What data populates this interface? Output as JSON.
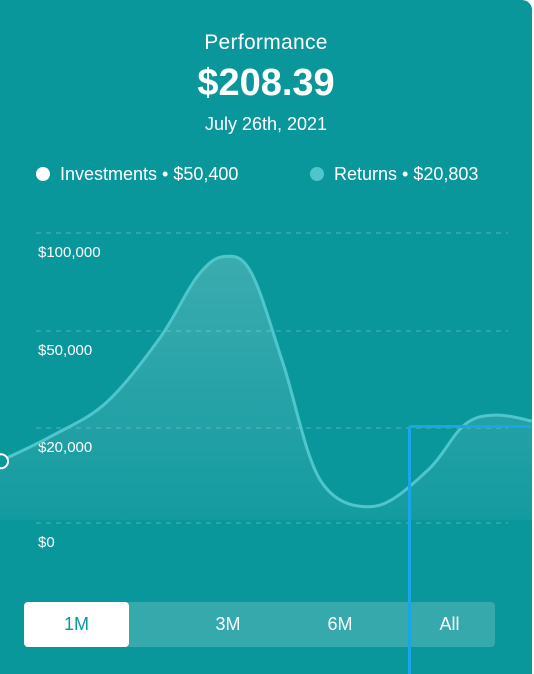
{
  "header": {
    "title": "Performance",
    "amount": "$208.39",
    "date": "July 26th, 2021"
  },
  "legend": [
    {
      "label": "Investments",
      "value": "$50,400",
      "color": "#ffffff"
    },
    {
      "label": "Returns",
      "value": "$20,803",
      "color": "#4fc6cb"
    }
  ],
  "legend_separator": "•",
  "colors": {
    "card_background": "#0a979c",
    "curve_line": "#4fc6cb",
    "selection_outline": "#1aa6e6"
  },
  "chart_data": {
    "type": "area",
    "y_tick_labels": [
      "$100,000",
      "$50,000",
      "$20,000",
      "$0"
    ],
    "grid": true,
    "series": [
      {
        "color": "#4fc6cb",
        "points": [
          {
            "x": 0,
            "y": 13000
          },
          {
            "x": 0.1,
            "y": 18500
          },
          {
            "x": 0.2,
            "y": 28000
          },
          {
            "x": 0.3,
            "y": 48000
          },
          {
            "x": 0.37,
            "y": 78000
          },
          {
            "x": 0.42,
            "y": 88000
          },
          {
            "x": 0.47,
            "y": 80000
          },
          {
            "x": 0.53,
            "y": 40000
          },
          {
            "x": 0.6,
            "y": 9000
          },
          {
            "x": 0.7,
            "y": 3500
          },
          {
            "x": 0.8,
            "y": 11000
          },
          {
            "x": 0.87,
            "y": 21000
          },
          {
            "x": 0.93,
            "y": 24000
          },
          {
            "x": 1,
            "y": 22000
          }
        ]
      }
    ]
  },
  "tabs": [
    {
      "label": "1M",
      "active": true
    },
    {
      "label": "3M",
      "active": false
    },
    {
      "label": "6M",
      "active": false
    },
    {
      "label": "All",
      "active": false
    }
  ]
}
